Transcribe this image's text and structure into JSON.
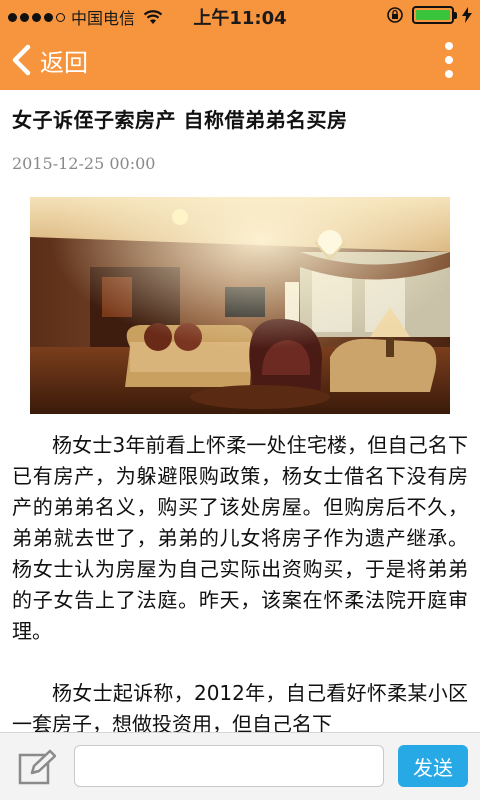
{
  "status_bar": {
    "carrier": "中国电信",
    "time": "上午11:04",
    "battery_level": 1.0,
    "colors": {
      "background": "#f7953e",
      "battery_fill": "#39c43b"
    }
  },
  "nav": {
    "back_label": "返回",
    "icons": {
      "back": "chevron-left-icon",
      "menu": "more-vertical-icon"
    },
    "colors": {
      "background": "#f7953e"
    }
  },
  "article": {
    "title": "女子诉侄子索房产 自称借弟弟名买房",
    "date": "2015-12-25 00:00",
    "paragraphs": [
      "杨女士3年前看上怀柔一处住宅楼，但自己名下已有房产，为躲避限购政策，杨女士借名下没有房产的弟弟名义，购买了该处房屋。但购房后不久，弟弟就去世了，弟弟的儿女将房子作为遗产继承。杨女士认为房屋为自己实际出资购买，于是将弟弟的子女告上了法庭。昨天，该案在怀柔法院开庭审理。",
      "杨女士起诉称，2012年，自己看好怀柔某小区一套房子，想做投资用，但自己名下"
    ]
  },
  "composer": {
    "placeholder": "",
    "value": "",
    "send_label": "发送",
    "icons": {
      "edit": "edit-pencil-icon"
    },
    "colors": {
      "send_button": "#27a9e6"
    }
  }
}
